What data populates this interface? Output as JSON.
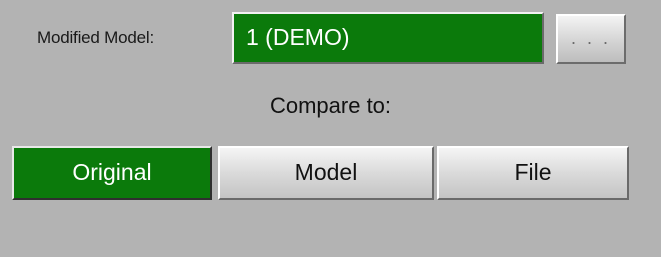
{
  "modified_model": {
    "label": "Modified Model:",
    "value": "1 (DEMO)",
    "browse_label": ". . ."
  },
  "compare": {
    "label": "Compare to:",
    "options": [
      {
        "label": "Original",
        "selected": true
      },
      {
        "label": "Model",
        "selected": false
      },
      {
        "label": "File",
        "selected": false
      }
    ]
  },
  "colors": {
    "background": "#b3b3b3",
    "accent_green": "#0b7a0b",
    "button_face": "#d4d4d4"
  }
}
